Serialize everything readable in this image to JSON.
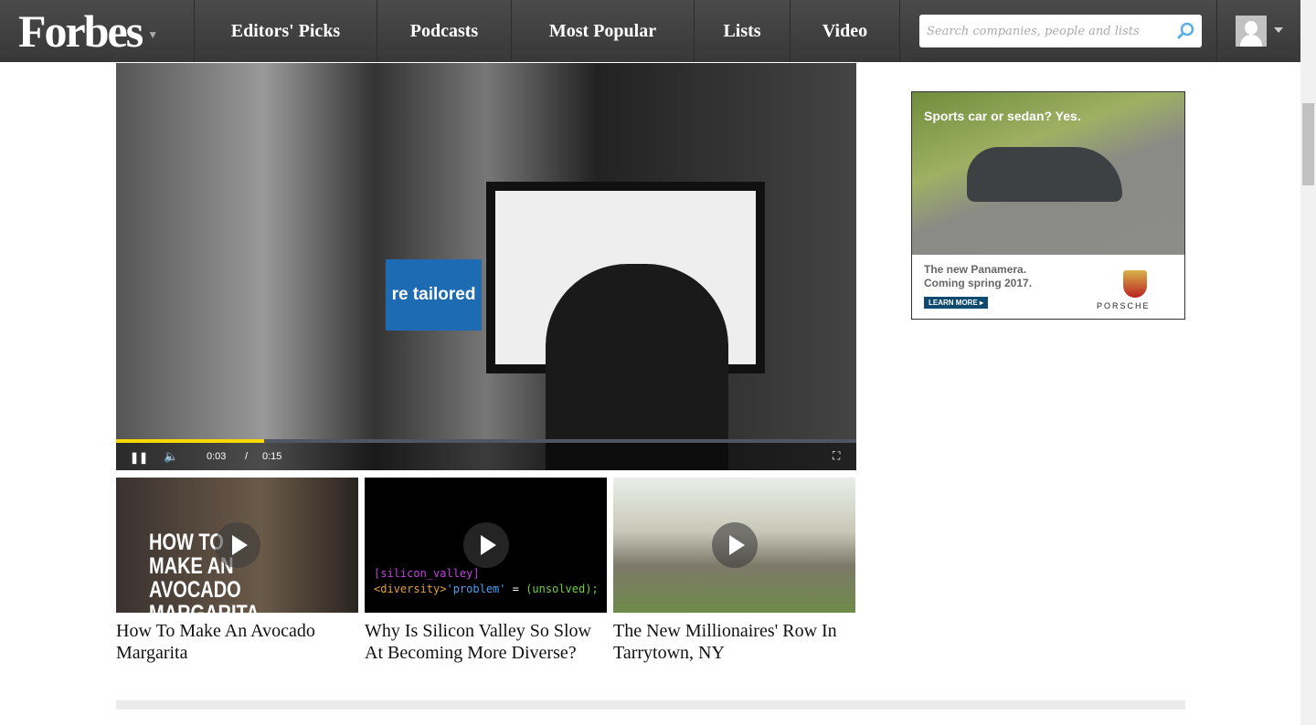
{
  "nav": {
    "logo": "Forbes",
    "items": [
      "Editors' Picks",
      "Podcasts",
      "Most Popular",
      "Lists",
      "Video"
    ],
    "search_placeholder": "Search companies, people and lists"
  },
  "video": {
    "overlay_text": "re tailored",
    "current_time": "0:03",
    "separator": "/",
    "duration": "0:15",
    "progress_percent": 20
  },
  "related": [
    {
      "title": "How To Make An Avocado Margarita",
      "thumb_text": "HOW TO MAKE AN AVOCADO MARGARITA"
    },
    {
      "title": "Why Is Silicon Valley So Slow At Becoming More Diverse?",
      "code_line1": "[silicon_valley]",
      "code_line2a": "<diversity>",
      "code_line2b": "'problem'",
      "code_line2c": " = ",
      "code_line2d": "(unsolved);"
    },
    {
      "title": "The New Millionaires' Row In Tarrytown, NY"
    }
  ],
  "ad": {
    "headline": "Sports car or sedan?  Yes.",
    "line1": "The new Panamera.",
    "line2": "Coming spring 2017.",
    "button": "LEARN MORE ▸",
    "brand": "PORSCHE"
  }
}
